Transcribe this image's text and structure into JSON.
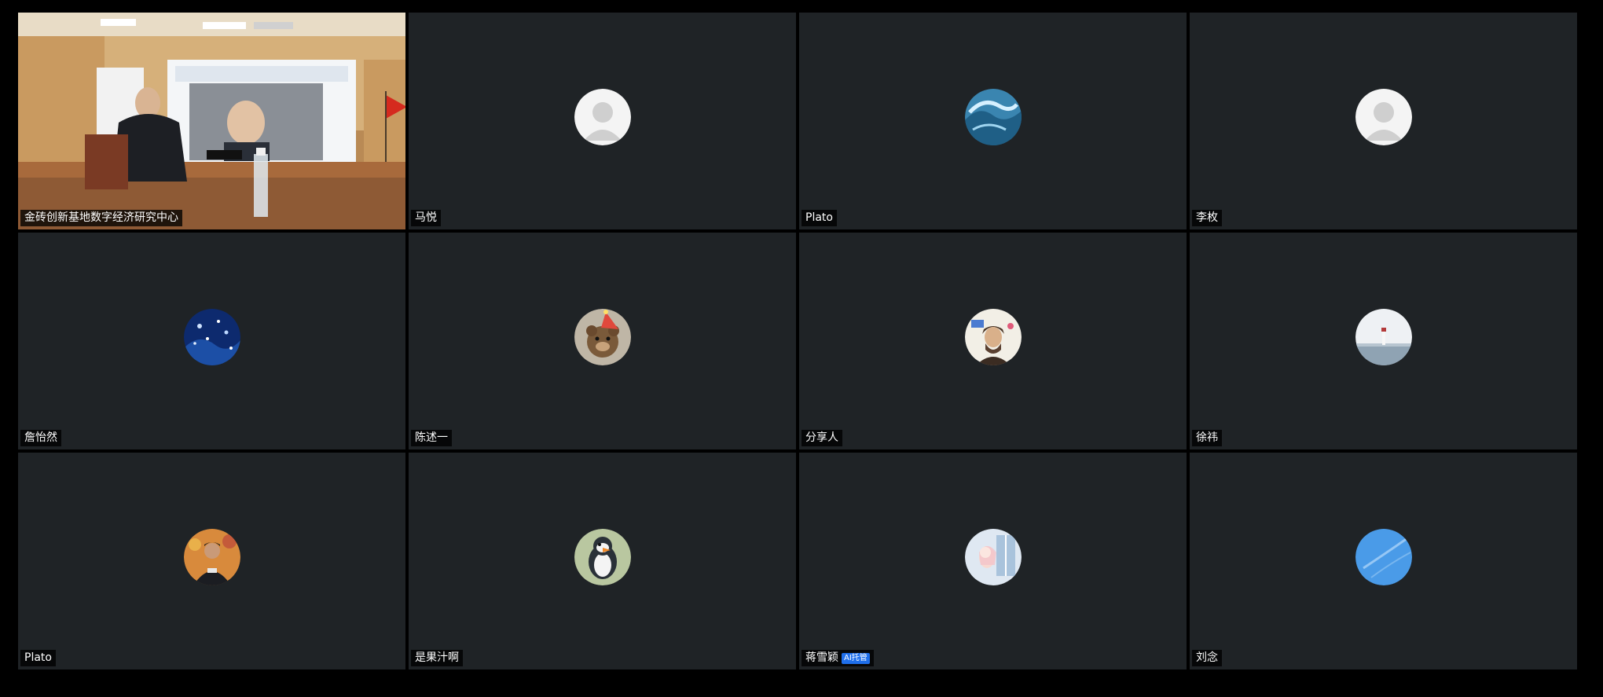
{
  "meeting": {
    "participants": [
      {
        "name": "金砖创新基地数字经济研究中心",
        "avatar": "video-feed",
        "video_on": true,
        "active_speaker": true
      },
      {
        "name": "马悦",
        "avatar": "default-person-icon"
      },
      {
        "name": "Plato",
        "avatar": "ocean-wave-avatar"
      },
      {
        "name": "李枚",
        "avatar": "default-person-icon"
      },
      {
        "name": "詹怡然",
        "avatar": "starry-night-avatar"
      },
      {
        "name": "陈述一",
        "avatar": "party-bear-avatar"
      },
      {
        "name": "分享人",
        "avatar": "portrait-painting-avatar"
      },
      {
        "name": "徐祎",
        "avatar": "lighthouse-avatar"
      },
      {
        "name": "Plato",
        "avatar": "person-photo-avatar"
      },
      {
        "name": "是果汁啊",
        "avatar": "penguin-avatar"
      },
      {
        "name": "蒋雪颖",
        "avatar": "cartoon-window-avatar",
        "badge": "AI托管"
      },
      {
        "name": "刘念",
        "avatar": "blue-sky-avatar"
      }
    ]
  },
  "colors": {
    "background": "#000000",
    "tile": "#1f2326",
    "active_border": "#46c36b",
    "ai_badge": "#1f6feb"
  }
}
